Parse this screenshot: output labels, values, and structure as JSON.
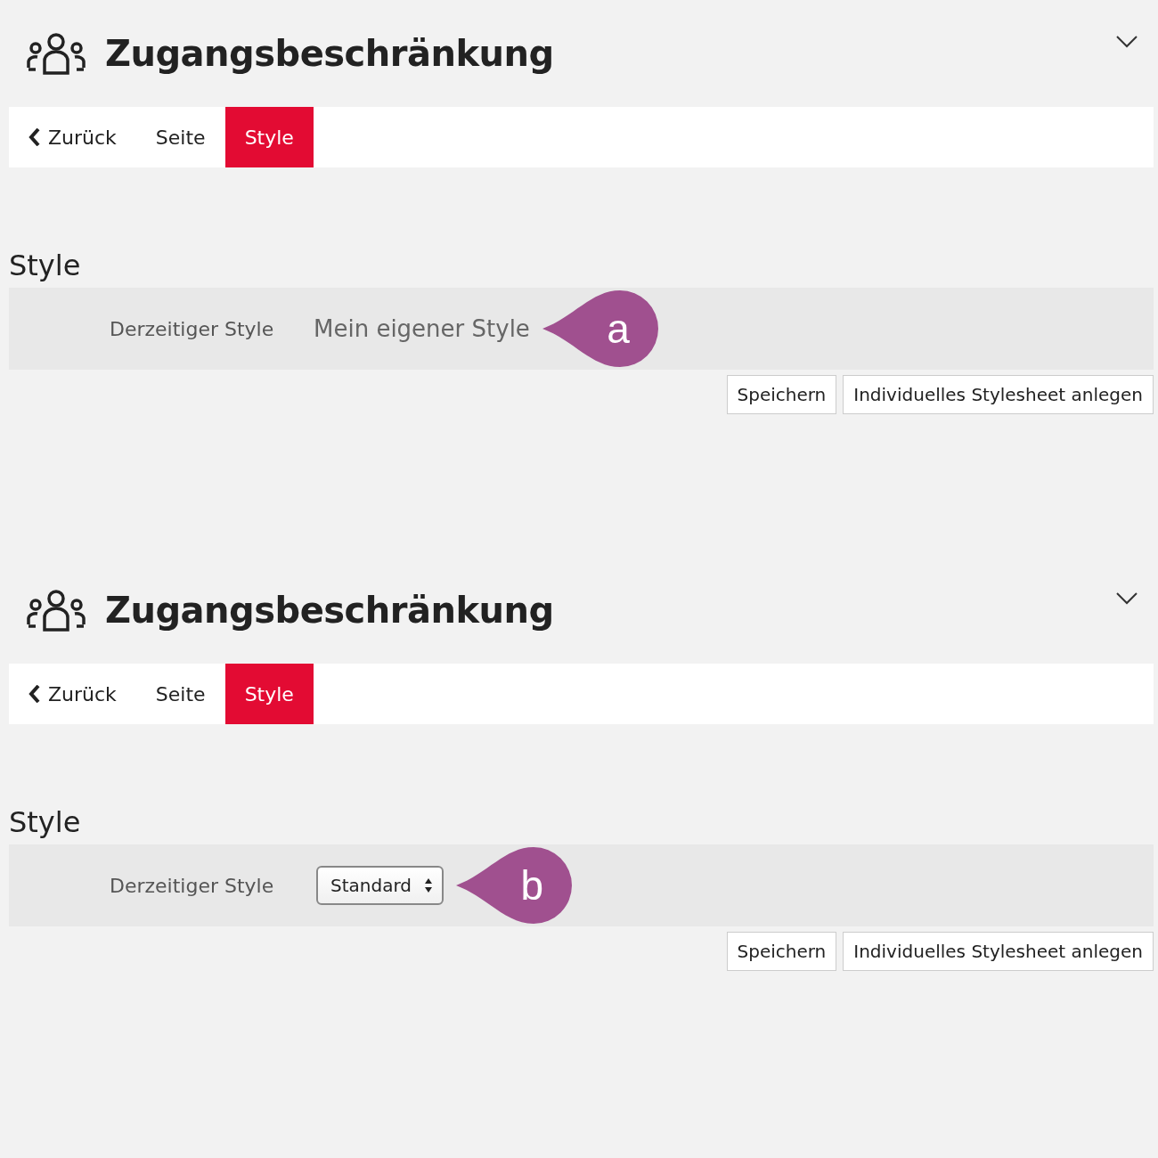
{
  "panels": [
    {
      "title": "Zugangsbeschränkung",
      "tabs": [
        {
          "kind": "back",
          "label": "Zurück",
          "selected": false
        },
        {
          "kind": "tab",
          "label": "Seite",
          "selected": false
        },
        {
          "kind": "tab",
          "label": "Style",
          "selected": true
        }
      ],
      "section_title": "Style",
      "field": {
        "label": "Derzeitiger Style",
        "kind": "text",
        "value": "Mein eigener Style"
      },
      "callout": "a",
      "buttons": [
        "Speichern",
        "Individuelles Stylesheet anlegen"
      ]
    },
    {
      "title": "Zugangsbeschränkung",
      "tabs": [
        {
          "kind": "back",
          "label": "Zurück",
          "selected": false
        },
        {
          "kind": "tab",
          "label": "Seite",
          "selected": false
        },
        {
          "kind": "tab",
          "label": "Style",
          "selected": true
        }
      ],
      "section_title": "Style",
      "field": {
        "label": "Derzeitiger Style",
        "kind": "select",
        "value": "Standard"
      },
      "callout": "b",
      "buttons": [
        "Speichern",
        "Individuelles Stylesheet anlegen"
      ]
    }
  ]
}
